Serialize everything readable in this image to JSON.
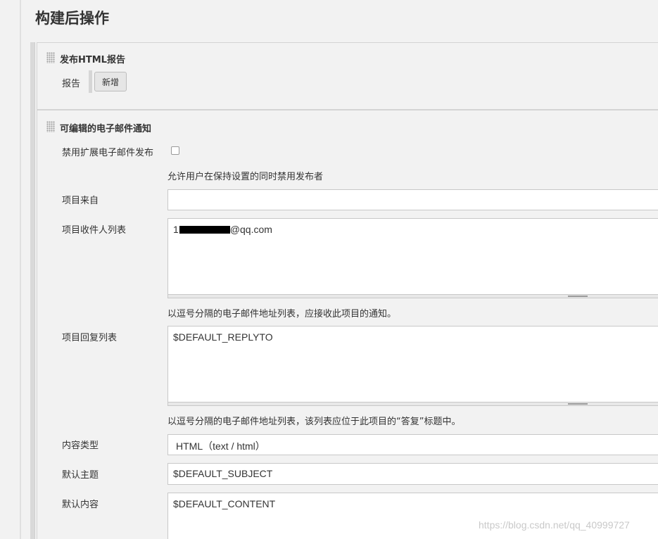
{
  "page": {
    "title": "构建后操作"
  },
  "publish_html": {
    "title": "发布HTML报告",
    "report_label": "报告",
    "add_button": "新增"
  },
  "email": {
    "title": "可编辑的电子邮件通知",
    "disable_label": "禁用扩展电子邮件发布",
    "disable_hint": "允许用户在保持设置的同时禁用发布者",
    "from_label": "项目来自",
    "from_value": "",
    "recipients_label": "项目收件人列表",
    "recipients_prefix": "1",
    "recipients_suffix": "@qq.com",
    "recipients_hint": "以逗号分隔的电子邮件地址列表，应接收此项目的通知。",
    "replyto_label": "项目回复列表",
    "replyto_value": "$DEFAULT_REPLYTO",
    "replyto_hint": "以逗号分隔的电子邮件地址列表，该列表应位于此项目的“答复”标题中。",
    "content_type_label": "内容类型",
    "content_type_value": "HTML（text / html）",
    "subject_label": "默认主题",
    "subject_value": "$DEFAULT_SUBJECT",
    "content_label": "默认内容",
    "content_value": "$DEFAULT_CONTENT"
  },
  "watermark": "https://blog.csdn.net/qq_40999727"
}
